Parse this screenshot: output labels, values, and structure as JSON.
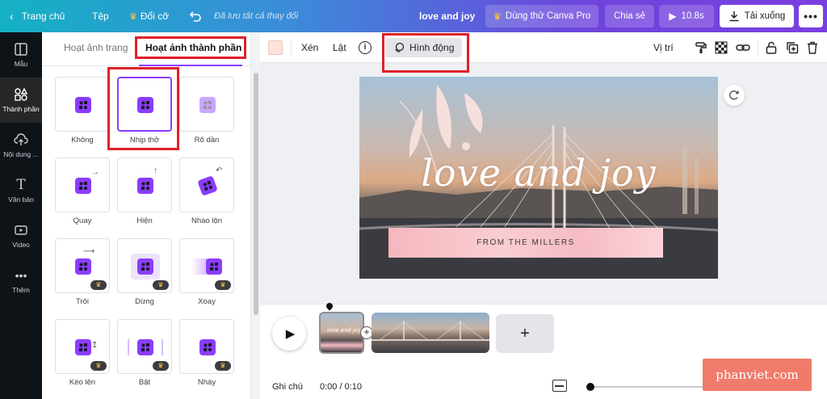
{
  "topbar": {
    "home_label": "Trang chủ",
    "file_label": "Tệp",
    "resize_label": "Đổi cỡ",
    "saved_status": "Đã lưu tất cả thay đổi",
    "design_title": "love and joy",
    "try_pro_label": "Dùng thử Canva Pro",
    "share_label": "Chia sẻ",
    "play_label": "10.8s",
    "download_label": "Tải xuống"
  },
  "rail": {
    "items": [
      {
        "label": "Mẫu"
      },
      {
        "label": "Thành phần"
      },
      {
        "label": "Nội dung ..."
      },
      {
        "label": "Văn bản"
      },
      {
        "label": "Video"
      },
      {
        "label": "Thêm"
      }
    ]
  },
  "panel": {
    "tabs": [
      {
        "label": "Hoạt ảnh trang"
      },
      {
        "label": "Hoạt ảnh thành phần"
      }
    ],
    "animations": [
      {
        "label": "Không",
        "pro": false
      },
      {
        "label": "Nhịp thở",
        "pro": false
      },
      {
        "label": "Rõ dần",
        "pro": false
      },
      {
        "label": "Quay",
        "pro": false
      },
      {
        "label": "Hiện",
        "pro": false
      },
      {
        "label": "Nhào lộn",
        "pro": false
      },
      {
        "label": "Trôi",
        "pro": true
      },
      {
        "label": "Dừng",
        "pro": true
      },
      {
        "label": "Xoay",
        "pro": true
      },
      {
        "label": "Kéo lên",
        "pro": true
      },
      {
        "label": "Bật",
        "pro": true
      },
      {
        "label": "Nháy",
        "pro": true
      }
    ],
    "selected": "Nhịp thở"
  },
  "toolbar": {
    "color_swatch": "#fde3da",
    "crop_label": "Xén",
    "flip_label": "Lật",
    "animate_label": "Hình động",
    "position_label": "Vị trí"
  },
  "design": {
    "title_text": "love and joy",
    "banner_text": "FROM THE MILLERS"
  },
  "timeline": {
    "notes_label": "Ghi chú",
    "time_display": "0:00 / 0:10"
  },
  "watermark": "phanviet.com",
  "colors": {
    "accent": "#8b3dff",
    "highlight_border": "#e0202a",
    "watermark_bg": "#f07b6b"
  }
}
